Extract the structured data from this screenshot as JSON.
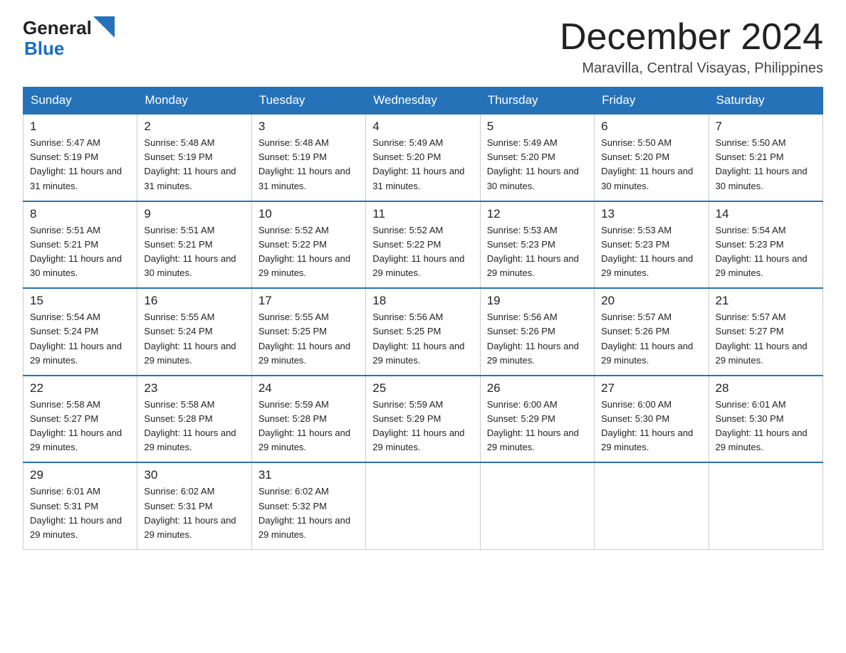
{
  "logo": {
    "general": "General",
    "blue": "Blue",
    "alt": "GeneralBlue logo"
  },
  "header": {
    "month_year": "December 2024",
    "location": "Maravilla, Central Visayas, Philippines"
  },
  "weekdays": [
    "Sunday",
    "Monday",
    "Tuesday",
    "Wednesday",
    "Thursday",
    "Friday",
    "Saturday"
  ],
  "weeks": [
    [
      {
        "day": "1",
        "sunrise": "Sunrise: 5:47 AM",
        "sunset": "Sunset: 5:19 PM",
        "daylight": "Daylight: 11 hours and 31 minutes."
      },
      {
        "day": "2",
        "sunrise": "Sunrise: 5:48 AM",
        "sunset": "Sunset: 5:19 PM",
        "daylight": "Daylight: 11 hours and 31 minutes."
      },
      {
        "day": "3",
        "sunrise": "Sunrise: 5:48 AM",
        "sunset": "Sunset: 5:19 PM",
        "daylight": "Daylight: 11 hours and 31 minutes."
      },
      {
        "day": "4",
        "sunrise": "Sunrise: 5:49 AM",
        "sunset": "Sunset: 5:20 PM",
        "daylight": "Daylight: 11 hours and 31 minutes."
      },
      {
        "day": "5",
        "sunrise": "Sunrise: 5:49 AM",
        "sunset": "Sunset: 5:20 PM",
        "daylight": "Daylight: 11 hours and 30 minutes."
      },
      {
        "day": "6",
        "sunrise": "Sunrise: 5:50 AM",
        "sunset": "Sunset: 5:20 PM",
        "daylight": "Daylight: 11 hours and 30 minutes."
      },
      {
        "day": "7",
        "sunrise": "Sunrise: 5:50 AM",
        "sunset": "Sunset: 5:21 PM",
        "daylight": "Daylight: 11 hours and 30 minutes."
      }
    ],
    [
      {
        "day": "8",
        "sunrise": "Sunrise: 5:51 AM",
        "sunset": "Sunset: 5:21 PM",
        "daylight": "Daylight: 11 hours and 30 minutes."
      },
      {
        "day": "9",
        "sunrise": "Sunrise: 5:51 AM",
        "sunset": "Sunset: 5:21 PM",
        "daylight": "Daylight: 11 hours and 30 minutes."
      },
      {
        "day": "10",
        "sunrise": "Sunrise: 5:52 AM",
        "sunset": "Sunset: 5:22 PM",
        "daylight": "Daylight: 11 hours and 29 minutes."
      },
      {
        "day": "11",
        "sunrise": "Sunrise: 5:52 AM",
        "sunset": "Sunset: 5:22 PM",
        "daylight": "Daylight: 11 hours and 29 minutes."
      },
      {
        "day": "12",
        "sunrise": "Sunrise: 5:53 AM",
        "sunset": "Sunset: 5:23 PM",
        "daylight": "Daylight: 11 hours and 29 minutes."
      },
      {
        "day": "13",
        "sunrise": "Sunrise: 5:53 AM",
        "sunset": "Sunset: 5:23 PM",
        "daylight": "Daylight: 11 hours and 29 minutes."
      },
      {
        "day": "14",
        "sunrise": "Sunrise: 5:54 AM",
        "sunset": "Sunset: 5:23 PM",
        "daylight": "Daylight: 11 hours and 29 minutes."
      }
    ],
    [
      {
        "day": "15",
        "sunrise": "Sunrise: 5:54 AM",
        "sunset": "Sunset: 5:24 PM",
        "daylight": "Daylight: 11 hours and 29 minutes."
      },
      {
        "day": "16",
        "sunrise": "Sunrise: 5:55 AM",
        "sunset": "Sunset: 5:24 PM",
        "daylight": "Daylight: 11 hours and 29 minutes."
      },
      {
        "day": "17",
        "sunrise": "Sunrise: 5:55 AM",
        "sunset": "Sunset: 5:25 PM",
        "daylight": "Daylight: 11 hours and 29 minutes."
      },
      {
        "day": "18",
        "sunrise": "Sunrise: 5:56 AM",
        "sunset": "Sunset: 5:25 PM",
        "daylight": "Daylight: 11 hours and 29 minutes."
      },
      {
        "day": "19",
        "sunrise": "Sunrise: 5:56 AM",
        "sunset": "Sunset: 5:26 PM",
        "daylight": "Daylight: 11 hours and 29 minutes."
      },
      {
        "day": "20",
        "sunrise": "Sunrise: 5:57 AM",
        "sunset": "Sunset: 5:26 PM",
        "daylight": "Daylight: 11 hours and 29 minutes."
      },
      {
        "day": "21",
        "sunrise": "Sunrise: 5:57 AM",
        "sunset": "Sunset: 5:27 PM",
        "daylight": "Daylight: 11 hours and 29 minutes."
      }
    ],
    [
      {
        "day": "22",
        "sunrise": "Sunrise: 5:58 AM",
        "sunset": "Sunset: 5:27 PM",
        "daylight": "Daylight: 11 hours and 29 minutes."
      },
      {
        "day": "23",
        "sunrise": "Sunrise: 5:58 AM",
        "sunset": "Sunset: 5:28 PM",
        "daylight": "Daylight: 11 hours and 29 minutes."
      },
      {
        "day": "24",
        "sunrise": "Sunrise: 5:59 AM",
        "sunset": "Sunset: 5:28 PM",
        "daylight": "Daylight: 11 hours and 29 minutes."
      },
      {
        "day": "25",
        "sunrise": "Sunrise: 5:59 AM",
        "sunset": "Sunset: 5:29 PM",
        "daylight": "Daylight: 11 hours and 29 minutes."
      },
      {
        "day": "26",
        "sunrise": "Sunrise: 6:00 AM",
        "sunset": "Sunset: 5:29 PM",
        "daylight": "Daylight: 11 hours and 29 minutes."
      },
      {
        "day": "27",
        "sunrise": "Sunrise: 6:00 AM",
        "sunset": "Sunset: 5:30 PM",
        "daylight": "Daylight: 11 hours and 29 minutes."
      },
      {
        "day": "28",
        "sunrise": "Sunrise: 6:01 AM",
        "sunset": "Sunset: 5:30 PM",
        "daylight": "Daylight: 11 hours and 29 minutes."
      }
    ],
    [
      {
        "day": "29",
        "sunrise": "Sunrise: 6:01 AM",
        "sunset": "Sunset: 5:31 PM",
        "daylight": "Daylight: 11 hours and 29 minutes."
      },
      {
        "day": "30",
        "sunrise": "Sunrise: 6:02 AM",
        "sunset": "Sunset: 5:31 PM",
        "daylight": "Daylight: 11 hours and 29 minutes."
      },
      {
        "day": "31",
        "sunrise": "Sunrise: 6:02 AM",
        "sunset": "Sunset: 5:32 PM",
        "daylight": "Daylight: 11 hours and 29 minutes."
      },
      null,
      null,
      null,
      null
    ]
  ]
}
